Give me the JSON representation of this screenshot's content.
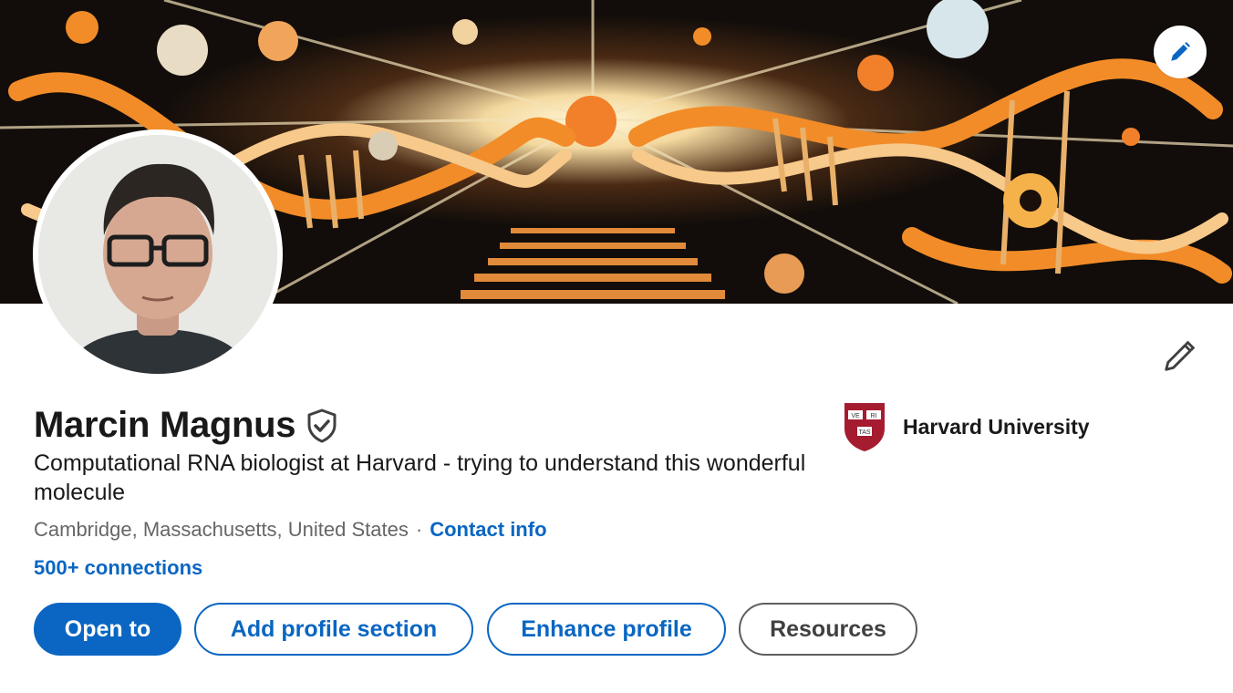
{
  "profile": {
    "name": "Marcin Magnus",
    "headline": "Computational RNA biologist at Harvard - trying to understand this wonderful molecule",
    "location": "Cambridge, Massachusetts, United States",
    "separator": "·",
    "contact_label": "Contact info",
    "connections": "500+ connections"
  },
  "education": {
    "school_name": "Harvard University",
    "logo_text_top": [
      "VE",
      "RI"
    ],
    "logo_text_bottom": "TAS"
  },
  "actions": {
    "open_to": "Open to",
    "add_section": "Add profile section",
    "enhance": "Enhance profile",
    "resources": "Resources"
  },
  "icons": {
    "banner_edit": "pencil-icon",
    "profile_edit": "pencil-icon",
    "verified": "verified-shield-icon"
  },
  "colors": {
    "accent": "#0a66c2",
    "harvard_crimson": "#a51c30",
    "banner_orange": "#f28c28"
  }
}
